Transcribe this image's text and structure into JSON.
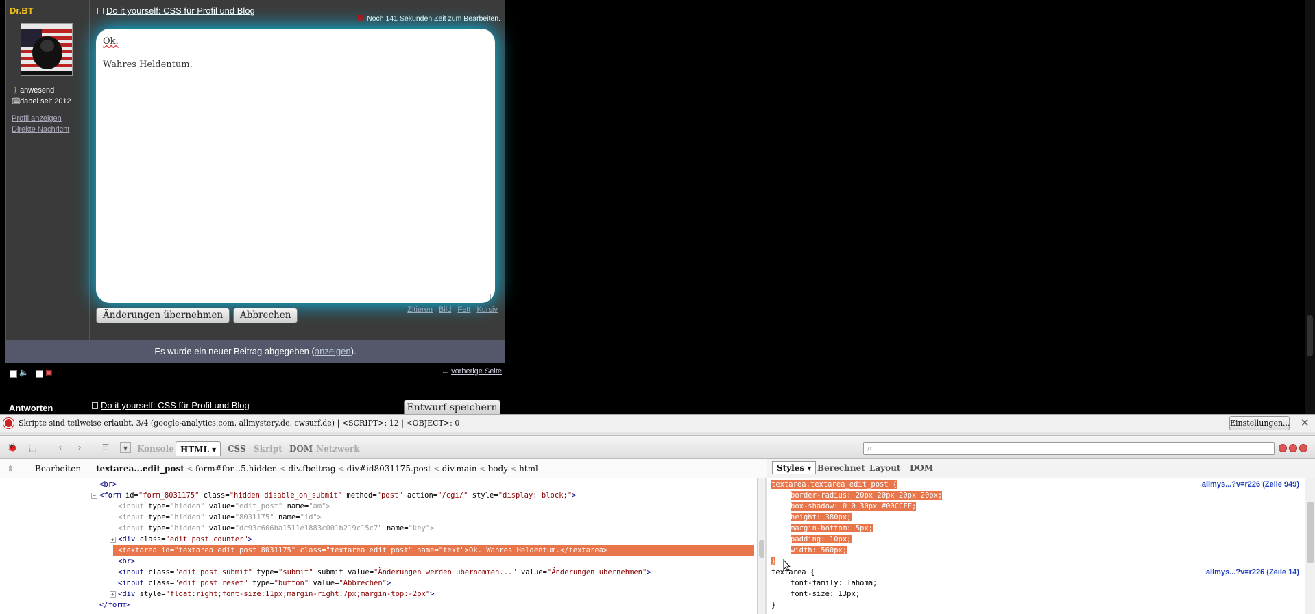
{
  "post": {
    "author": {
      "name": "Dr.BT",
      "avatar_alt": "",
      "status": "anwesend",
      "since": "dabei seit 2012",
      "links": [
        "Profil anzeigen",
        "Direkte Nachricht"
      ]
    },
    "title": "Do it yourself: CSS für Profil und Blog",
    "counter": "Noch 141 Sekunden Zeit zum Bearbeiten.",
    "editor_lines": [
      "Ok.",
      "Wahres Heldentum."
    ],
    "buttons": {
      "apply": "Änderungen übernehmen",
      "cancel": "Abbrechen"
    },
    "format_links": [
      "Zitieren",
      "Bild",
      "Fett",
      "Kursiv"
    ],
    "new_post_notice": {
      "before": "Es wurde ein neuer Beitrag abgegeben (",
      "link": "anzeigen",
      "after": ")."
    },
    "prev_page": "vorherige Seite",
    "answer_label": "Antworten",
    "reply_title": "Do it yourself: CSS für Profil und Blog",
    "draft_button": "Entwurf speichern"
  },
  "noscript": {
    "message": "Skripte sind teilweise erlaubt, 3/4 (google-analytics.com, allmystery.de, cwsurf.de) | <SCRIPT>: 12 | <OBJECT>: 0",
    "settings_button": "Einstellungen...",
    "close": "✕"
  },
  "firebug": {
    "tabs": [
      "Konsole",
      "HTML",
      "CSS",
      "Skript",
      "DOM",
      "Netzwerk"
    ],
    "active_tab": "HTML",
    "edit_button": "Bearbeiten",
    "breadcrumb": [
      "textarea...edit_post",
      "form#for...5.hidden",
      "div.fbeitrag",
      "div#id8031175.post",
      "div.main",
      "body",
      "html"
    ],
    "side_tabs": [
      "Styles",
      "Berechnet",
      "Layout",
      "DOM"
    ],
    "active_side_tab": "Styles",
    "html_lines": [
      {
        "text": "<br>",
        "kind": "tag"
      },
      {
        "tag": "form",
        "attrs": [
          [
            "id",
            "form_8031175"
          ],
          [
            "class",
            "hidden disable_on_submit"
          ],
          [
            "method",
            "post"
          ],
          [
            "action",
            "/cgi/"
          ],
          [
            "style",
            "display: block;"
          ]
        ],
        "kind": "open"
      },
      {
        "tag": "input",
        "attrs": [
          [
            "type",
            "hidden"
          ],
          [
            "value",
            "edit_post"
          ],
          [
            "name",
            "am"
          ]
        ],
        "kind": "gray"
      },
      {
        "tag": "input",
        "attrs": [
          [
            "type",
            "hidden"
          ],
          [
            "value",
            "8031175"
          ],
          [
            "name",
            "id"
          ]
        ],
        "kind": "gray"
      },
      {
        "tag": "input",
        "attrs": [
          [
            "type",
            "hidden"
          ],
          [
            "value",
            "dc93c606ba1511e1883c001b219c15c7"
          ],
          [
            "name",
            "key"
          ]
        ],
        "kind": "gray"
      },
      {
        "tag": "div",
        "attrs": [
          [
            "class",
            "edit_post_counter"
          ]
        ],
        "kind": "collapsed"
      },
      {
        "text": "<textarea id=\"textarea_edit_post_8031175\" class=\"textarea_edit_post\" name=\"text\">Ok. Wahres Heldentum.</textarea>",
        "kind": "selected"
      },
      {
        "text": "<br>",
        "kind": "tag"
      },
      {
        "tag": "input",
        "attrs": [
          [
            "class",
            "edit_post_submit"
          ],
          [
            "type",
            "submit"
          ],
          [
            "submit_value",
            "Änderungen werden übernommen..."
          ],
          [
            "value",
            "Änderungen übernehmen"
          ]
        ],
        "kind": "normal"
      },
      {
        "tag": "input",
        "attrs": [
          [
            "class",
            "edit_post_reset"
          ],
          [
            "type",
            "button"
          ],
          [
            "value",
            "Abbrechen"
          ]
        ],
        "kind": "normal"
      },
      {
        "tag": "div",
        "attrs": [
          [
            "style",
            "float:right;font-size:11px;margin-right:7px;margin-top:-2px"
          ]
        ],
        "kind": "collapsed"
      },
      {
        "text": "</form>",
        "kind": "tag"
      }
    ],
    "rules": [
      {
        "selector": "textarea.textarea_edit_post {",
        "source": "allmys...?v=r226 (Zeile 949)",
        "highlighted": true,
        "props": [
          "border-radius: 20px 20px 20px 20px;",
          "box-shadow: 0 0 30px #00CCFF;",
          "height: 380px;",
          "margin-bottom: 5px;",
          "padding: 10px;",
          "width: 560px;"
        ],
        "close": "}"
      },
      {
        "selector": "textarea {",
        "source": "allmys...?v=r226 (Zeile 14)",
        "highlighted": false,
        "props": [
          "font-family: Tahoma;",
          "font-size: 13px;"
        ],
        "close": "}"
      }
    ]
  },
  "colors": {
    "highlight": "#e9754a",
    "glow": "#00CCFF",
    "author_name": "#f0c020"
  }
}
